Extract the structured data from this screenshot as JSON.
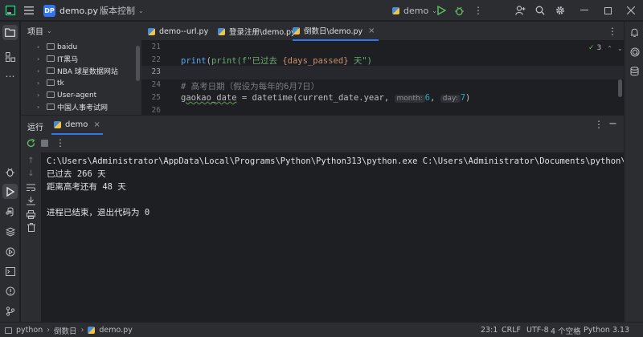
{
  "titlebar": {
    "project_badge": "DP",
    "file_name": "demo.py",
    "vcs_menu": "版本控制",
    "run_config": "demo"
  },
  "project_panel": {
    "title": "项目",
    "items": [
      {
        "label": "baidu"
      },
      {
        "label": "IT黑马"
      },
      {
        "label": "NBA 球星数据网站"
      },
      {
        "label": "tk"
      },
      {
        "label": "User-agent"
      },
      {
        "label": "中国人事考试网"
      }
    ]
  },
  "editor": {
    "tabs": [
      {
        "label": "demo--url.py"
      },
      {
        "label": "登录注册\\demo.py"
      },
      {
        "label": "倒数日\\demo.py",
        "active": true
      }
    ],
    "warning_count": "3",
    "line_numbers": [
      "21",
      "22",
      "23",
      "24",
      "25",
      "26"
    ],
    "lines": {
      "l22_a": "print(f\"已过去 ",
      "l22_b": "{days_passed}",
      "l22_c": " 天\")",
      "l24": "# 高考日期（假设为每年的6月7日）",
      "l25_a": "gaokao_date",
      "l25_b": " = datetime(current_date.year, ",
      "l25_hint1": "month:",
      "l25_v1": "6",
      "l25_sep": ", ",
      "l25_hint2": "day:",
      "l25_v2": "7",
      "l25_end": ")"
    }
  },
  "run_panel": {
    "label": "运行",
    "tab": "demo",
    "console": [
      "C:\\Users\\Administrator\\AppData\\Local\\Programs\\Python\\Python313\\python.exe C:\\Users\\Administrator\\Documents\\python\\倒数日\\demo.py",
      "已过去 266 天",
      "距离高考还有 48 天",
      "",
      "进程已结束，退出代码为 0"
    ]
  },
  "statusbar": {
    "crumbs": [
      "python",
      "倒数日",
      "demo.py"
    ],
    "position": "23:1",
    "line_sep": "CRLF",
    "encoding": "UTF-8",
    "indent": "4 个空格",
    "interpreter": "Python 3.13"
  },
  "colors": {
    "accent": "#3574f0",
    "keyword_func": "#56a8f5",
    "string": "#6aab73",
    "comment": "#7a7e85",
    "number": "#2aacb8",
    "run_green": "#5fb865"
  }
}
